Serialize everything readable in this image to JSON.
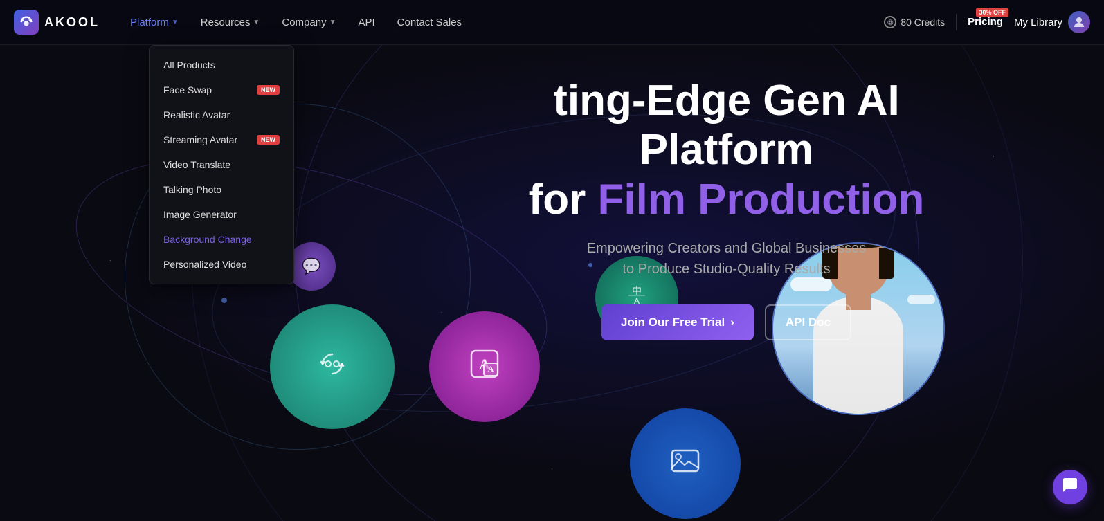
{
  "nav": {
    "logo_text": "AKOOL",
    "platform_label": "Platform",
    "resources_label": "Resources",
    "company_label": "Company",
    "api_label": "API",
    "contact_label": "Contact Sales",
    "credits_label": "80 Credits",
    "pricing_label": "Pricing",
    "discount_tag": "30% OFF",
    "my_library_label": "My Library"
  },
  "dropdown": {
    "items": [
      {
        "label": "All Products",
        "badge": null,
        "active": false
      },
      {
        "label": "Face Swap",
        "badge": "New",
        "active": false
      },
      {
        "label": "Realistic Avatar",
        "badge": null,
        "active": false
      },
      {
        "label": "Streaming Avatar",
        "badge": "New",
        "active": false
      },
      {
        "label": "Video Translate",
        "badge": null,
        "active": false
      },
      {
        "label": "Talking Photo",
        "badge": null,
        "active": false
      },
      {
        "label": "Image Generator",
        "badge": null,
        "active": false
      },
      {
        "label": "Background Change",
        "badge": null,
        "active": true
      },
      {
        "label": "Personalized Video",
        "badge": null,
        "active": false
      }
    ]
  },
  "hero": {
    "title_line1": "ting-Edge Gen AI Platform",
    "title_line2_plain": "for ",
    "title_line2_highlight": "Film Production",
    "subtitle_line1": "Empowering Creators and Global Businesses",
    "subtitle_line2": "to Produce Studio-Quality Results",
    "cta_primary": "Join Our Free Trial",
    "cta_secondary": "API Doc"
  },
  "chat": {
    "icon": "💬"
  },
  "orbs": [
    {
      "icon": "💱",
      "size": "sm",
      "label": "translate-icon"
    },
    {
      "icon": "🖼",
      "size": "lg",
      "label": "image-gen-icon"
    },
    {
      "icon": "🈶",
      "size": "teal-sm",
      "label": "video-translate-icon"
    },
    {
      "icon": "🖼",
      "size": "blue-lg",
      "label": "background-icon"
    }
  ]
}
